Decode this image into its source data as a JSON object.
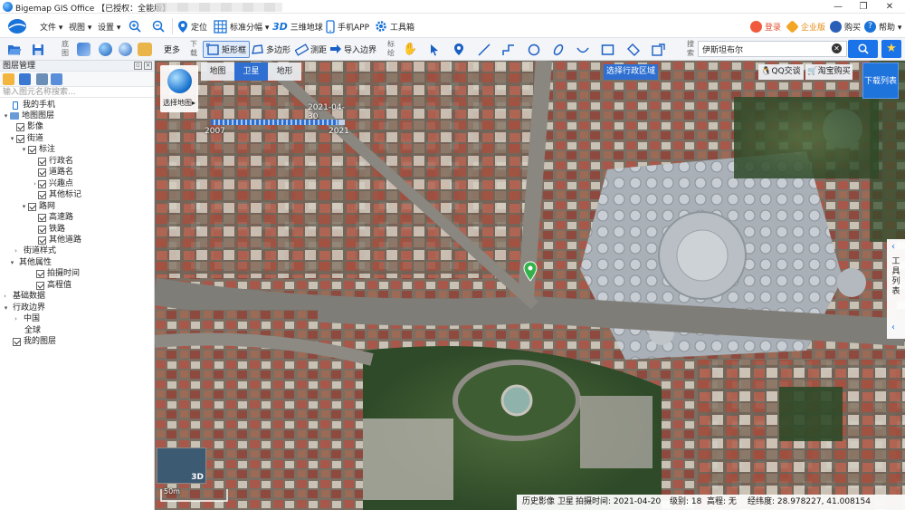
{
  "titlebar": {
    "title": "Bigemap GIS Office 【已授权：全能版】",
    "minimize": "—",
    "restore": "❐",
    "close": "✕"
  },
  "menu": {
    "file": "文件 ▾",
    "view": "视图 ▾",
    "settings": "设置 ▾",
    "locate": "定位",
    "std_sheet": "标准分幅 ▾",
    "globe3d": "三维地球",
    "mobile": "手机APP",
    "toolbox": "工具箱",
    "login": "登录",
    "enterprise": "企业版",
    "buy": "购买",
    "help": "帮助 ▾"
  },
  "toolbar": {
    "group_map": "底图",
    "group_download": "下载",
    "group_mark": "标绘",
    "group_search": "搜索",
    "more": "更多",
    "rect_box": "矩形框",
    "polygon": "多边形",
    "measure": "测距",
    "import_border": "导入边界",
    "search_value": "伊斯坦布尔"
  },
  "layer_panel": {
    "title": "图层管理",
    "search_placeholder": "输入图元名称搜索...",
    "items": [
      {
        "label": "我的手机"
      },
      {
        "label": "地图图层"
      },
      {
        "label": "影像"
      },
      {
        "label": "街道"
      },
      {
        "label": "标注"
      },
      {
        "label": "行政名"
      },
      {
        "label": "道路名"
      },
      {
        "label": "兴趣点"
      },
      {
        "label": "其他标记"
      },
      {
        "label": "路网"
      },
      {
        "label": "高速路"
      },
      {
        "label": "铁路"
      },
      {
        "label": "其他道路"
      },
      {
        "label": "街道样式"
      },
      {
        "label": "其他属性"
      },
      {
        "label": "拍摄时间"
      },
      {
        "label": "高程值"
      },
      {
        "label": "基础数据"
      },
      {
        "label": "行政边界"
      },
      {
        "label": "中国"
      },
      {
        "label": "全球"
      },
      {
        "label": "我的图层"
      }
    ]
  },
  "map": {
    "tabs": [
      "地图",
      "卫星",
      "地形"
    ],
    "selected_tab": "卫星",
    "select_map_label": "选择地图▸",
    "region_select": "选择行政区域",
    "qq": "QQ交谈",
    "taobao": "淘宝购买",
    "download_list": "下载列表",
    "tool_list": "工具列表",
    "timeline": {
      "start": "2007",
      "current": "2021-04-30",
      "end": "2021",
      "fill_fraction": 0.95
    },
    "minimap_label": "3D",
    "scale_label": "50m"
  },
  "status": {
    "history": "历史影像 卫星",
    "shot_time": "拍摄时间: 2021-04-20",
    "level": "级别: 18",
    "elevation": "高程: 无",
    "coords": "经纬度: 28.978227, 41.008154"
  }
}
